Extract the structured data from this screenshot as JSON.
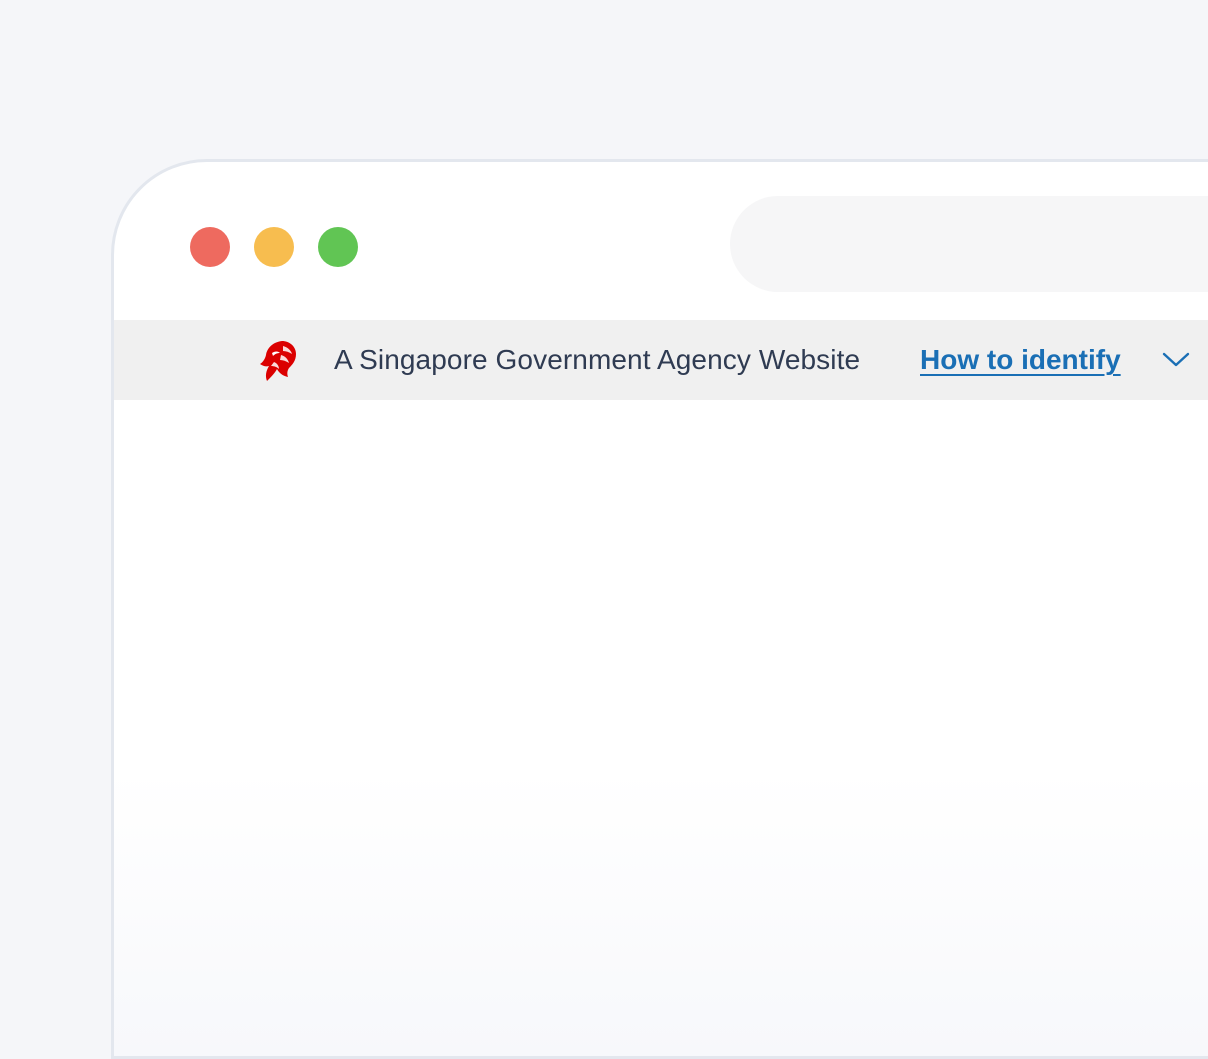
{
  "window": {
    "traffic_lights": [
      {
        "name": "close",
        "color": "#ee6a5f"
      },
      {
        "name": "minimize",
        "color": "#f7bd4f"
      },
      {
        "name": "maximize",
        "color": "#61c554"
      }
    ],
    "address_bar": {
      "value": ""
    }
  },
  "gov_banner": {
    "icon": "lion-head-icon",
    "icon_color": "#db0000",
    "text": "A Singapore Government Agency Website",
    "link_text": "How to identify",
    "link_color": "#1a6fb5",
    "chevron_icon": "chevron-down-icon"
  }
}
